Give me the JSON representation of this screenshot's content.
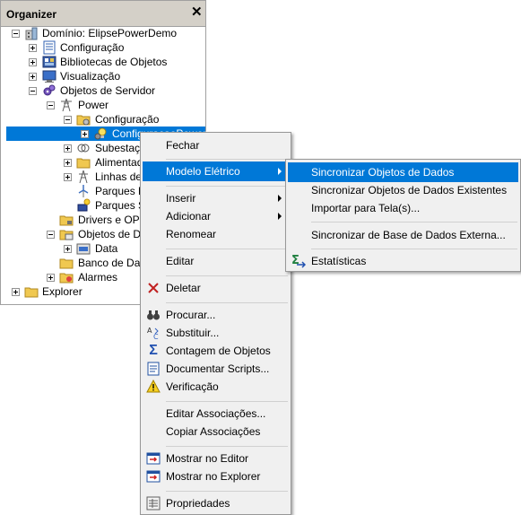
{
  "organizer": {
    "title": "Organizer",
    "close": "✕",
    "tree": [
      {
        "label": "Domínio: ElipsePowerDemo"
      },
      {
        "label": "Configuração"
      },
      {
        "label": "Bibliotecas de Objetos"
      },
      {
        "label": "Visualização"
      },
      {
        "label": "Objetos de Servidor"
      },
      {
        "label": "Power"
      },
      {
        "label": "Configuração"
      },
      {
        "label": "ConfiguracaoPower"
      },
      {
        "label": "Subestações"
      },
      {
        "label": "Alimentadores"
      },
      {
        "label": "Linhas de Transmissão"
      },
      {
        "label": "Parques Eólicos"
      },
      {
        "label": "Parques Solares"
      },
      {
        "label": "Drivers e OPC"
      },
      {
        "label": "Objetos de Dados"
      },
      {
        "label": "Data"
      },
      {
        "label": "Banco de Dados"
      },
      {
        "label": "Alarmes"
      },
      {
        "label": "Explorer"
      }
    ]
  },
  "context_menu": {
    "items": [
      {
        "label": "Fechar",
        "icon": ""
      },
      {
        "label": "Modelo Elétrico",
        "icon": ""
      },
      {
        "label": "Inserir",
        "icon": ""
      },
      {
        "label": "Adicionar",
        "icon": ""
      },
      {
        "label": "Renomear",
        "icon": ""
      },
      {
        "label": "Editar",
        "icon": ""
      },
      {
        "label": "Deletar",
        "icon": "delete-icon"
      },
      {
        "label": "Procurar...",
        "icon": "binoculars-icon"
      },
      {
        "label": "Substituir...",
        "icon": "replace-icon"
      },
      {
        "label": "Contagem de Objetos",
        "icon": "sigma-icon"
      },
      {
        "label": "Documentar Scripts...",
        "icon": "document-icon"
      },
      {
        "label": "Verificação",
        "icon": "warning-icon"
      },
      {
        "label": "Editar Associações...",
        "icon": ""
      },
      {
        "label": "Copiar Associações",
        "icon": ""
      },
      {
        "label": "Mostrar no Editor",
        "icon": "editor-icon"
      },
      {
        "label": "Mostrar no Explorer",
        "icon": "explorer-icon"
      },
      {
        "label": "Propriedades",
        "icon": "properties-icon"
      }
    ]
  },
  "submenu": {
    "items": [
      {
        "label": "Sincronizar Objetos de Dados"
      },
      {
        "label": "Sincronizar Objetos de Dados Existentes"
      },
      {
        "label": "Importar para Tela(s)..."
      },
      {
        "label": "Sincronizar de Base de Dados Externa..."
      },
      {
        "label": "Estatísticas"
      }
    ]
  },
  "colors": {
    "highlight": "#0078d7",
    "menu_bg": "#f0f0f0"
  }
}
